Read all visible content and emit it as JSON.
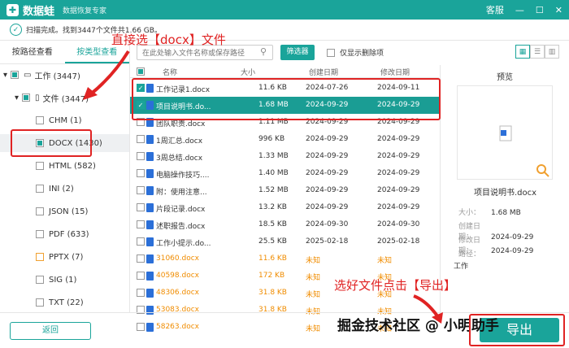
{
  "app": {
    "name": "数据蛙",
    "subtitle": "数据恢复专家",
    "service": "客服",
    "minimize": "—",
    "maximize": "☐",
    "close": "✕"
  },
  "status": {
    "prefix": "扫描完成。找到3447个文件共1.66 GB。",
    "icon": "check-circle-icon"
  },
  "annotations": {
    "top": "直接选【docx】文件",
    "bottom": "选好文件点击【导出】",
    "watermark": "掘金技术社区 @ 小明助手"
  },
  "tabs": [
    "按路径查看",
    "按类型查看"
  ],
  "tree": [
    {
      "label": "工作 (3447)",
      "indent": 0,
      "state": "partial",
      "icon": "drive"
    },
    {
      "label": "文件 (3447)",
      "indent": 1,
      "state": "partial",
      "icon": "folder"
    },
    {
      "label": "CHM (1)",
      "indent": 2,
      "state": "none"
    },
    {
      "label": "DOCX (1430)",
      "indent": 2,
      "state": "partial"
    },
    {
      "label": "HTML (582)",
      "indent": 2,
      "state": "none"
    },
    {
      "label": "INI (2)",
      "indent": 2,
      "state": "none"
    },
    {
      "label": "JSON (15)",
      "indent": 2,
      "state": "none"
    },
    {
      "label": "PDF (633)",
      "indent": 2,
      "state": "none"
    },
    {
      "label": "PPTX (7)",
      "indent": 2,
      "state": "orange"
    },
    {
      "label": "SIG (1)",
      "indent": 2,
      "state": "none"
    },
    {
      "label": "TXT (22)",
      "indent": 2,
      "state": "none"
    }
  ],
  "toolbar": {
    "search_placeholder": "在此处输入文件名称或保存路径",
    "filter": "筛选器",
    "only_deleted": "仅显示删除项"
  },
  "columns": {
    "name": "名称",
    "size": "大小",
    "created": "创建日期",
    "modified": "修改日期"
  },
  "rows": [
    {
      "name": "工作记录1.docx",
      "size": "11.6 KB",
      "created": "2024-07-26",
      "modified": "2024-09-11",
      "checked": true,
      "sel": false,
      "orange": false
    },
    {
      "name": "项目说明书.do...",
      "size": "1.68 MB",
      "created": "2024-09-29",
      "modified": "2024-09-29",
      "checked": true,
      "sel": true,
      "orange": false
    },
    {
      "name": "团队职责.docx",
      "size": "1.11 MB",
      "created": "2024-09-29",
      "modified": "2024-09-29",
      "checked": false,
      "sel": false,
      "orange": false
    },
    {
      "name": "1周汇总.docx",
      "size": "996 KB",
      "created": "2024-09-29",
      "modified": "2024-09-29",
      "checked": false,
      "sel": false,
      "orange": false
    },
    {
      "name": "3周总结.docx",
      "size": "1.33 MB",
      "created": "2024-09-29",
      "modified": "2024-09-29",
      "checked": false,
      "sel": false,
      "orange": false
    },
    {
      "name": "电脑操作技巧....",
      "size": "1.40 MB",
      "created": "2024-09-29",
      "modified": "2024-09-29",
      "checked": false,
      "sel": false,
      "orange": false
    },
    {
      "name": "附：使用注意...",
      "size": "1.52 MB",
      "created": "2024-09-29",
      "modified": "2024-09-29",
      "checked": false,
      "sel": false,
      "orange": false
    },
    {
      "name": "片段记录.docx",
      "size": "13.2 KB",
      "created": "2024-09-29",
      "modified": "2024-09-29",
      "checked": false,
      "sel": false,
      "orange": false
    },
    {
      "name": "述职报告.docx",
      "size": "18.5 KB",
      "created": "2024-09-30",
      "modified": "2024-09-30",
      "checked": false,
      "sel": false,
      "orange": false
    },
    {
      "name": "工作小提示.do...",
      "size": "25.5 KB",
      "created": "2025-02-18",
      "modified": "2025-02-18",
      "checked": false,
      "sel": false,
      "orange": false
    },
    {
      "name": "31060.docx",
      "size": "11.6 KB",
      "created": "未知",
      "modified": "未知",
      "checked": false,
      "sel": false,
      "orange": true
    },
    {
      "name": "40598.docx",
      "size": "172 KB",
      "created": "未知",
      "modified": "未知",
      "checked": false,
      "sel": false,
      "orange": true
    },
    {
      "name": "48306.docx",
      "size": "31.8 KB",
      "created": "未知",
      "modified": "未知",
      "checked": false,
      "sel": false,
      "orange": true
    },
    {
      "name": "53083.docx",
      "size": "31.8 KB",
      "created": "未知",
      "modified": "未知",
      "checked": false,
      "sel": false,
      "orange": true
    },
    {
      "name": "58263.docx",
      "size": "",
      "created": "未知",
      "modified": "未知",
      "checked": false,
      "sel": false,
      "orange": true
    }
  ],
  "preview": {
    "title": "预览",
    "filename": "项目说明书.docx",
    "size_label": "大小：",
    "size": "1.68 MB",
    "created_label": "创建日期：",
    "created": "2024-09-29",
    "modified_label": "修改日期：",
    "modified": "2024-09-29",
    "path_label": "路径：",
    "path": "工作"
  },
  "buttons": {
    "back": "返回",
    "export": "导出"
  },
  "colors": {
    "accent": "#1aa49a",
    "annotation": "#e02323",
    "unknown": "#f08c00"
  }
}
